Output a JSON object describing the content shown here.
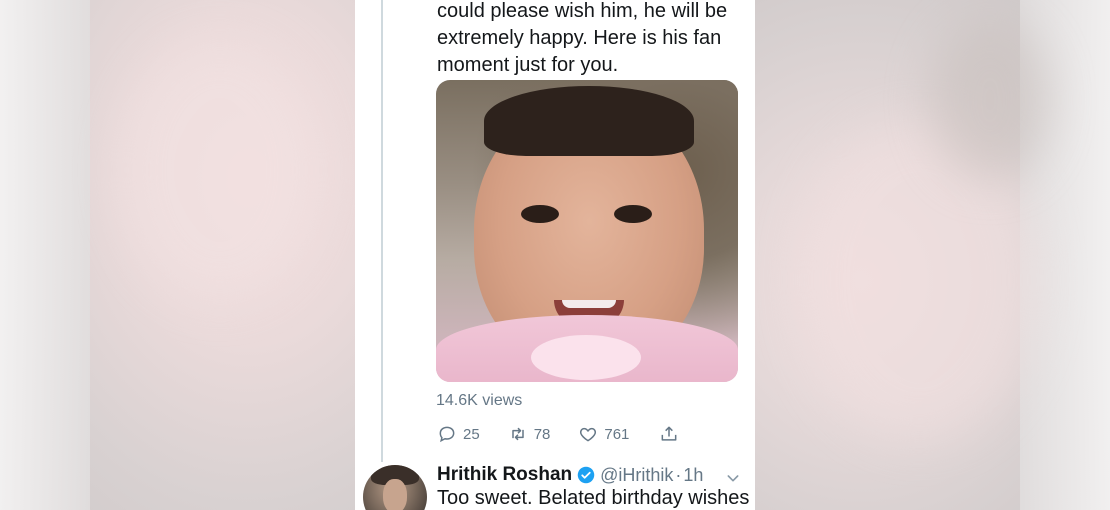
{
  "tweet": {
    "text_lines": [
      "could please wish him, he will be",
      "extremely happy. Here is his fan",
      "moment just for you."
    ],
    "views": "14.6K views",
    "actions": {
      "reply_count": "25",
      "retweet_count": "78",
      "like_count": "761"
    }
  },
  "reply": {
    "name": "Hrithik Roshan",
    "handle": "@iHrithik",
    "separator": "·",
    "time": "1h",
    "text": "Too sweet. Belated birthday wishes"
  },
  "icons": {
    "reply": "reply-icon",
    "retweet": "retweet-icon",
    "like": "heart-icon",
    "share": "share-icon",
    "verified": "verified-badge-icon",
    "more": "chevron-down-icon"
  },
  "colors": {
    "text": "#14171a",
    "secondary": "#657786",
    "verified": "#1da1f2",
    "thread_line": "#cfd9de"
  }
}
